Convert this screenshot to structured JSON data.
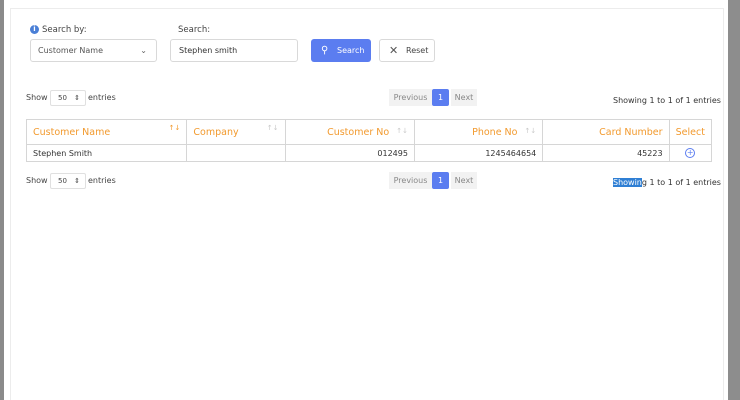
{
  "search_form": {
    "search_by_label": "Search by:",
    "search_by_value": "Customer Name",
    "search_label": "Search:",
    "search_value": "Stephen smith",
    "search_button": "Search",
    "reset_button": "Reset"
  },
  "length_top": {
    "show": "Show",
    "value": "50",
    "entries": "entries"
  },
  "length_bottom": {
    "show": "Show",
    "value": "50",
    "entries": "entries"
  },
  "pagination_top": {
    "previous": "Previous",
    "page": "1",
    "next": "Next"
  },
  "pagination_bottom": {
    "previous": "Previous",
    "page": "1",
    "next": "Next"
  },
  "info_top": "Showing 1 to 1 of 1 entries",
  "info_bottom": {
    "selected": "Showin",
    "rest": "g 1 to 1 of 1 entries"
  },
  "table": {
    "columns": [
      "Customer Name",
      "Company",
      "Customer No",
      "Phone No",
      "Card Number",
      "Select"
    ],
    "rows": [
      {
        "customer_name": "Stephen Smith",
        "company": "",
        "customer_no": "012495",
        "phone_no": "1245464654",
        "card_number": "45223"
      }
    ]
  },
  "colors": {
    "accent": "#5b7df0",
    "header_text": "#f29a2e",
    "selection": "#2f7fd4"
  }
}
